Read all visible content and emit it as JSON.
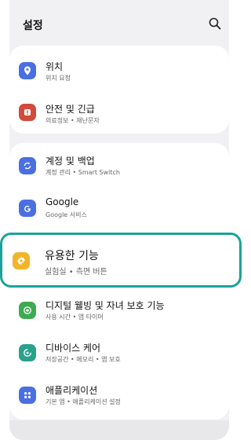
{
  "header": {
    "title": "설정"
  },
  "items": [
    {
      "label": "위치",
      "sub": "위치 요청",
      "icon": "location-pin-icon",
      "color": "#4a6fe3"
    },
    {
      "label": "안전 및 긴급",
      "sub": "의료정보 • 재난문자",
      "icon": "alert-icon",
      "color": "#d24a3c"
    },
    {
      "label": "계정 및 백업",
      "sub": "계정 관리 • Smart Switch",
      "icon": "sync-icon",
      "color": "#4a6fe3"
    },
    {
      "label": "Google",
      "sub": "Google 서비스",
      "icon": "google-icon",
      "color": "#4a6fe3"
    },
    {
      "label": "유용한 기능",
      "sub": "실험실 • 측면 버튼",
      "icon": "star-gear-icon",
      "color": "#f2b428"
    },
    {
      "label": "디지털 웰빙 및 자녀 보호 기능",
      "sub": "사용 시간 • 앱 타이머",
      "icon": "heart-circle-icon",
      "color": "#3cab52"
    },
    {
      "label": "디바이스 케어",
      "sub": "저장공간 • 메모리 • 앱 보호",
      "icon": "refresh-circle-icon",
      "color": "#2aa18a"
    },
    {
      "label": "애플리케이션",
      "sub": "기본 앱 • 애플리케이션 설정",
      "icon": "apps-grid-icon",
      "color": "#4a6fe3"
    }
  ],
  "colors": {
    "highlight_border": "#1aa39a",
    "background": "#f1f1f3"
  }
}
